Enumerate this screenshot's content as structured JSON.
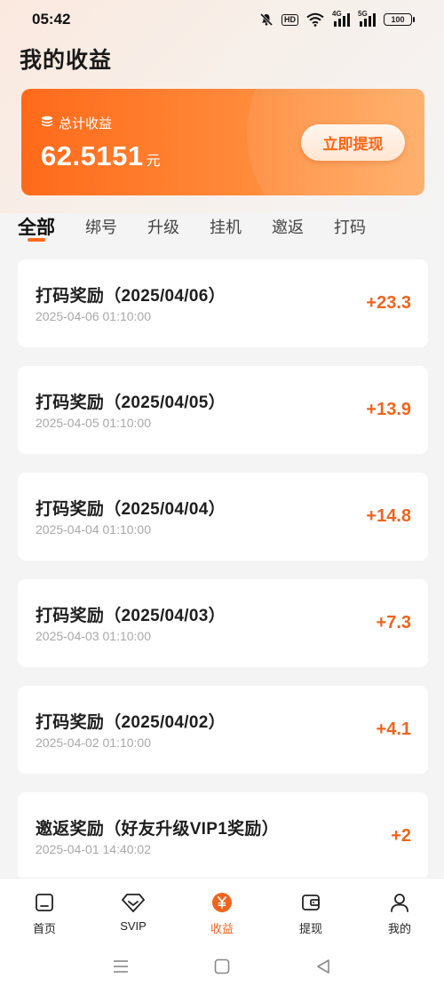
{
  "status_bar": {
    "time": "05:42",
    "hd_label": "HD",
    "signal1_label": "4G",
    "signal2_label": "5G",
    "battery": "100"
  },
  "page": {
    "title": "我的收益"
  },
  "earnings": {
    "label": "总计收益",
    "amount": "62.5151",
    "unit": "元",
    "withdraw_button": "立即提现"
  },
  "tabs": [
    {
      "label": "全部"
    },
    {
      "label": "绑号"
    },
    {
      "label": "升级"
    },
    {
      "label": "挂机"
    },
    {
      "label": "邀返"
    },
    {
      "label": "打码"
    }
  ],
  "records": [
    {
      "title": "打码奖励（2025/04/06）",
      "time": "2025-04-06 01:10:00",
      "amount": "+23.3"
    },
    {
      "title": "打码奖励（2025/04/05）",
      "time": "2025-04-05 01:10:00",
      "amount": "+13.9"
    },
    {
      "title": "打码奖励（2025/04/04）",
      "time": "2025-04-04 01:10:00",
      "amount": "+14.8"
    },
    {
      "title": "打码奖励（2025/04/03）",
      "time": "2025-04-03 01:10:00",
      "amount": "+7.3"
    },
    {
      "title": "打码奖励（2025/04/02）",
      "time": "2025-04-02 01:10:00",
      "amount": "+4.1"
    },
    {
      "title": "邀返奖励（好友升级VIP1奖励）",
      "time": "2025-04-01 14:40:02",
      "amount": "+2"
    }
  ],
  "bottom_nav": [
    {
      "label": "首页",
      "icon": "home-icon"
    },
    {
      "label": "SVIP",
      "icon": "diamond-icon"
    },
    {
      "label": "收益",
      "icon": "yen-coin-icon"
    },
    {
      "label": "提现",
      "icon": "wallet-icon"
    },
    {
      "label": "我的",
      "icon": "person-icon"
    }
  ],
  "colors": {
    "accent": "#ff6a1a",
    "amount": "#f0641e",
    "card_gradient_start": "#ff6a1a",
    "card_gradient_end": "#ffab63"
  }
}
